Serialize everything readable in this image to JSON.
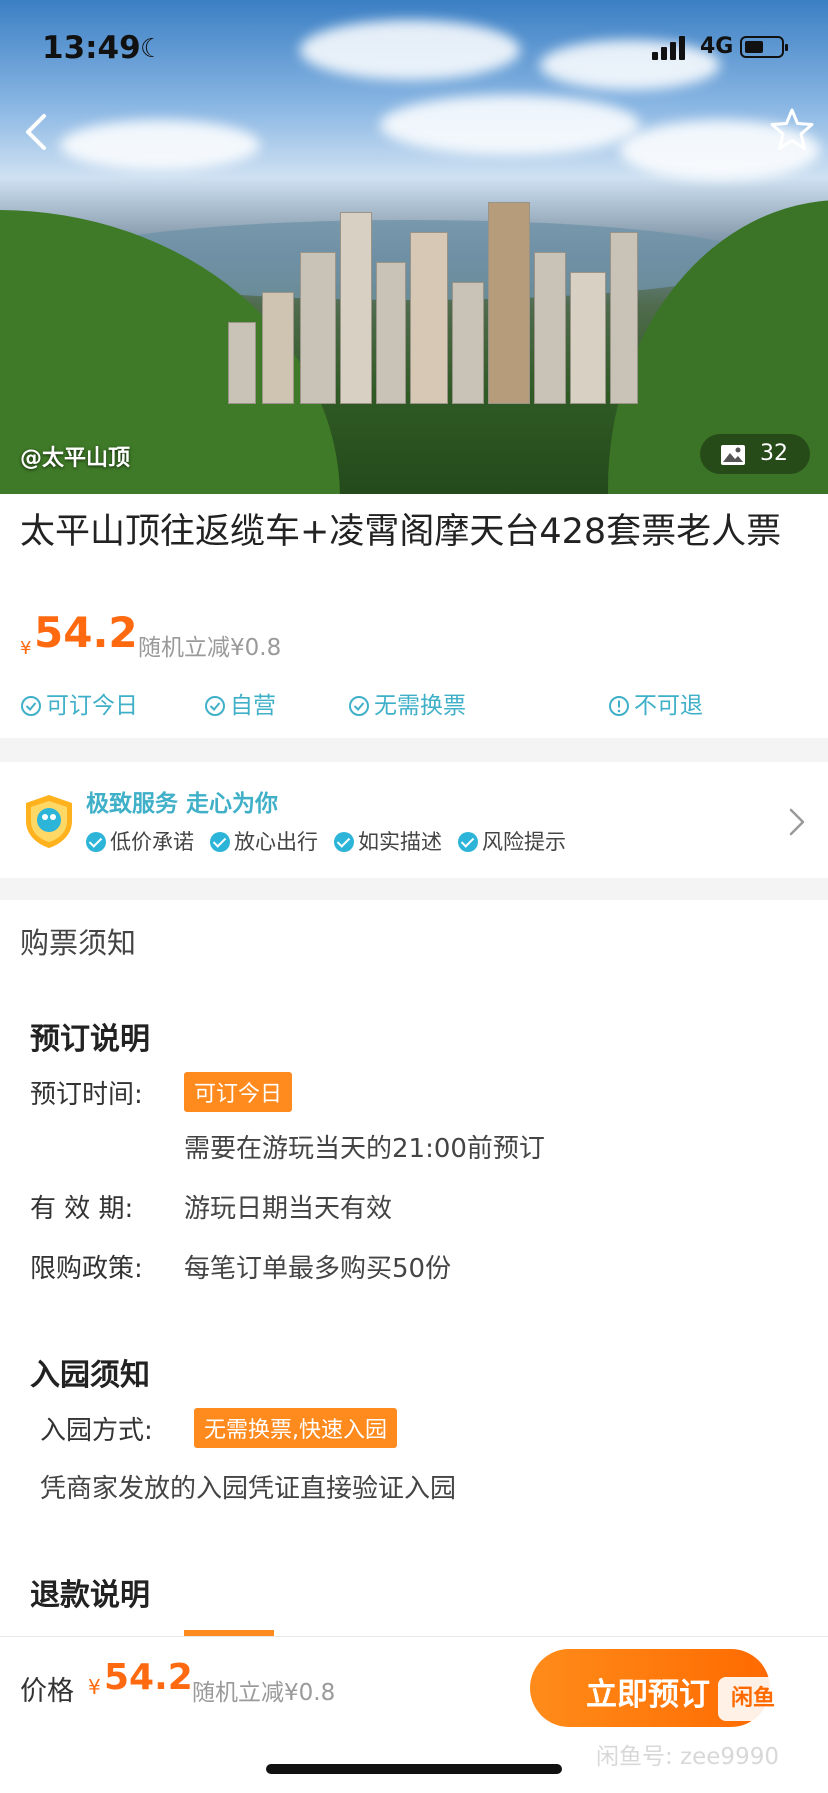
{
  "status_bar": {
    "time": "13:49",
    "network": "4G"
  },
  "hero": {
    "location_tag": "@太平山顶",
    "photo_count": "32"
  },
  "product": {
    "title": "太平山顶往返缆车+凌霄阁摩天台428套票老人票",
    "currency": "¥",
    "price": "54.2",
    "discount": "随机立减¥0.8",
    "tags": [
      "可订今日",
      "自营",
      "无需换票",
      "不可退"
    ]
  },
  "service": {
    "title": "极致服务 走心为你",
    "items": [
      "低价承诺",
      "放心出行",
      "如实描述",
      "风险提示"
    ]
  },
  "notice": {
    "section_title": "购票须知",
    "booking": {
      "title": "预订说明",
      "time_label": "预订时间:",
      "time_badge": "可订今日",
      "time_note": "需要在游玩当天的21:00前预订",
      "validity_label": "有 效 期:",
      "validity_value": "游玩日期当天有效",
      "limit_label": "限购政策:",
      "limit_value": "每笔订单最多购买50份"
    },
    "entry": {
      "title": "入园须知",
      "method_label": "入园方式:",
      "method_badge": "无需换票,快速入园",
      "method_note": "凭商家发放的入园凭证直接验证入园"
    },
    "refund": {
      "title": "退款说明"
    }
  },
  "bottom_bar": {
    "price_label": "价格",
    "currency": "¥",
    "price": "54.2",
    "discount": "随机立减¥0.8",
    "book_label": "立即预订",
    "logo_text": "闲鱼",
    "watermark": "闲鱼号: zee9990"
  },
  "colors": {
    "accent": "#ff6a10",
    "teal": "#3fb0c8",
    "badge": "#ff8a1e"
  }
}
